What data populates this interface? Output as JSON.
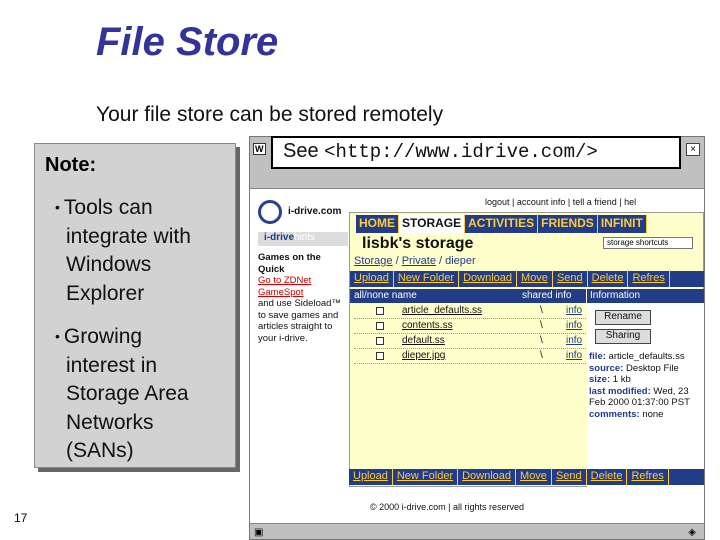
{
  "slide": {
    "title": "File Store",
    "subtitle": "Your file store can be stored remotely",
    "note_title": "Note:",
    "bullet_marker": "•",
    "bullets": [
      {
        "lines": [
          "Tools can",
          "integrate with",
          "Windows",
          "Explorer"
        ]
      },
      {
        "lines": [
          "Growing",
          "interest in",
          "Storage Area",
          "Networks",
          "(SANs)"
        ]
      }
    ],
    "page_number": "17",
    "url_callout": {
      "prefix": "See ",
      "url": "<http://www.idrive.com/>"
    }
  },
  "browser": {
    "window_badge": "W",
    "close_glyph": "×",
    "top_nav": "logout | account info | tell a friend | hel",
    "brand": "i-drive.com",
    "hints_label": "i-drive",
    "hints_suffix": "hints",
    "left_text": {
      "heading": "Games on the Quick",
      "link": "Go to ZDNet GameSpot",
      "rest": "and use Sideload™ to save games and articles straight to your i-drive."
    },
    "tabs": [
      "HOME",
      "STORAGE",
      "ACTIVITIES",
      "FRIENDS",
      "INFINIT"
    ],
    "active_tab": "STORAGE",
    "storage_heading": "lisbk's storage",
    "shortcuts_placeholder": "storage shortcuts",
    "breadcrumb": [
      "Storage",
      "Private",
      "dieper"
    ],
    "breadcrumb_sep": " / ",
    "toolbar": [
      "Upload",
      "New Folder",
      "Download",
      "Move",
      "Send",
      "Delete",
      "Refres"
    ],
    "column_headers": {
      "name": "all/none name",
      "shared": "shared info"
    },
    "files": [
      {
        "name": "article_defaults.ss",
        "mark": "\\",
        "info": "info"
      },
      {
        "name": "contents.ss",
        "mark": "\\",
        "info": "info"
      },
      {
        "name": "default.ss",
        "mark": "\\",
        "info": "info"
      },
      {
        "name": "dieper.jpg",
        "mark": "\\",
        "info": "info"
      }
    ],
    "information": {
      "heading": "Information",
      "rename_label": "Rename",
      "sharing_label": "Sharing",
      "file_label": "file:",
      "file": "article_defaults.ss",
      "source_label": "source:",
      "source": "Desktop File",
      "size_label": "size:",
      "size": "1 kb",
      "modified_label": "last modified:",
      "modified": "Wed, 23 Feb 2000 01:37:00 PST",
      "comments_label": "comments:",
      "comments": "none"
    },
    "copyright": "© 2000 i-drive.com | all rights reserved"
  },
  "colors": {
    "title": "#33339a",
    "navy": "#223c88",
    "gold": "#ffcc33",
    "panel": "#ffffcc",
    "note_bg": "#d2d2d2"
  }
}
